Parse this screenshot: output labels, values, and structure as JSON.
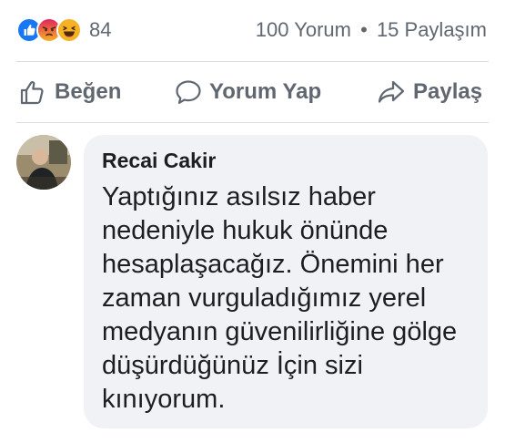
{
  "reactions": {
    "icons": [
      "like-reaction-icon",
      "angry-reaction-icon",
      "haha-reaction-icon"
    ],
    "count": "84",
    "colors": {
      "like": "#1877f2",
      "angry": "#e9710f",
      "haha": "#f7b125"
    }
  },
  "stats": {
    "comments": "100 Yorum",
    "separator": "•",
    "shares": "15 Paylaşım"
  },
  "actions": {
    "like_label": "Beğen",
    "comment_label": "Yorum Yap",
    "share_label": "Paylaş"
  },
  "comment": {
    "author": "Recai Cakir",
    "text": "Yaptığınız asılsız haber nedeniyle hukuk önünde hesaplaşacağız. Önemini her zaman vurguladığımız yerel medyanın güvenilirliğine gölge düşürdüğünüz İçin sizi kınıyorum."
  },
  "colors": {
    "secondary_text": "#606770",
    "bubble_bg": "#f0f2f5",
    "divider": "#dadde1"
  }
}
